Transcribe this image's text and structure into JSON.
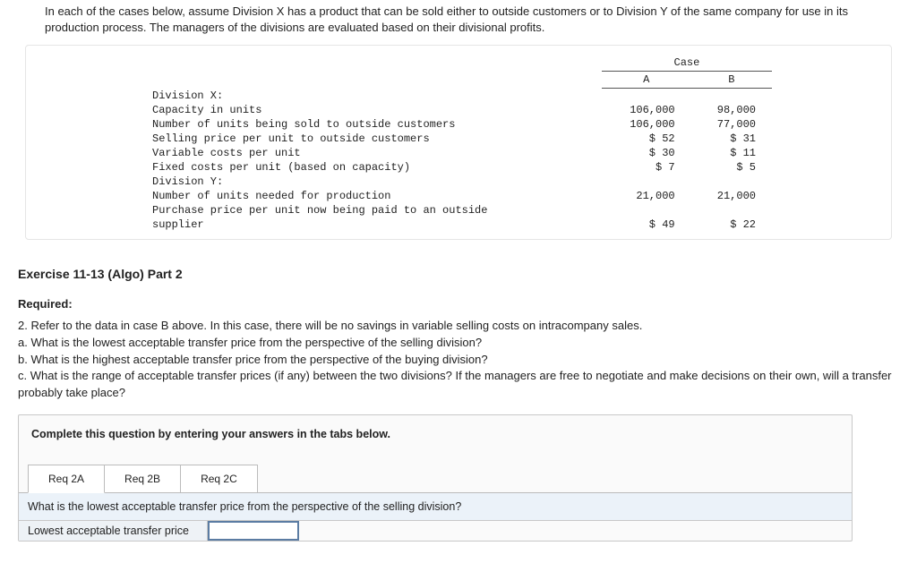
{
  "intro": "In each of the cases below, assume Division X has a product that can be sold either to outside customers or to Division Y of the same company for use in its production process. The managers of the divisions are evaluated based on their divisional profits.",
  "case": {
    "header_span": "Case",
    "col_a": "A",
    "col_b": "B",
    "rows": {
      "divx": "Division X:",
      "capacity": "Capacity in units",
      "capacity_a": "106,000",
      "capacity_b": "98,000",
      "sold": "Number of units being sold to outside customers",
      "sold_a": "106,000",
      "sold_b": "77,000",
      "sp": "Selling price per unit to outside customers",
      "sp_a": "$ 52",
      "sp_b": "$ 31",
      "vc": "Variable costs per unit",
      "vc_a": "$ 30",
      "vc_b": "$ 11",
      "fc": "Fixed costs per unit (based on capacity)",
      "fc_a": "$ 7",
      "fc_b": "$ 5",
      "divy": "Division Y:",
      "need": "Number of units needed for production",
      "need_a": "21,000",
      "need_b": "21,000",
      "pp1": "Purchase price per unit now being paid to an outside",
      "pp2": "supplier",
      "pp_a": "$ 49",
      "pp_b": "$ 22"
    }
  },
  "exercise_title": "Exercise 11-13 (Algo) Part 2",
  "required_label": "Required:",
  "required_text": "2. Refer to the data in case B above. In this case, there will be no savings in variable selling costs on intracompany sales.\na. What is the lowest acceptable transfer price from the perspective of the selling division?\nb. What is the highest acceptable transfer price from the perspective of the buying division?\nc. What is the range of acceptable transfer prices (if any) between the two divisions? If the managers are free to negotiate and make decisions on their own, will a transfer probably take place?",
  "complete_instruction": "Complete this question by entering your answers in the tabs below.",
  "tabs": {
    "a": "Req 2A",
    "b": "Req 2B",
    "c": "Req 2C"
  },
  "tab2a": {
    "prompt": "What is the lowest acceptable transfer price from the perspective of the selling division?",
    "label": "Lowest acceptable transfer price",
    "value": ""
  }
}
